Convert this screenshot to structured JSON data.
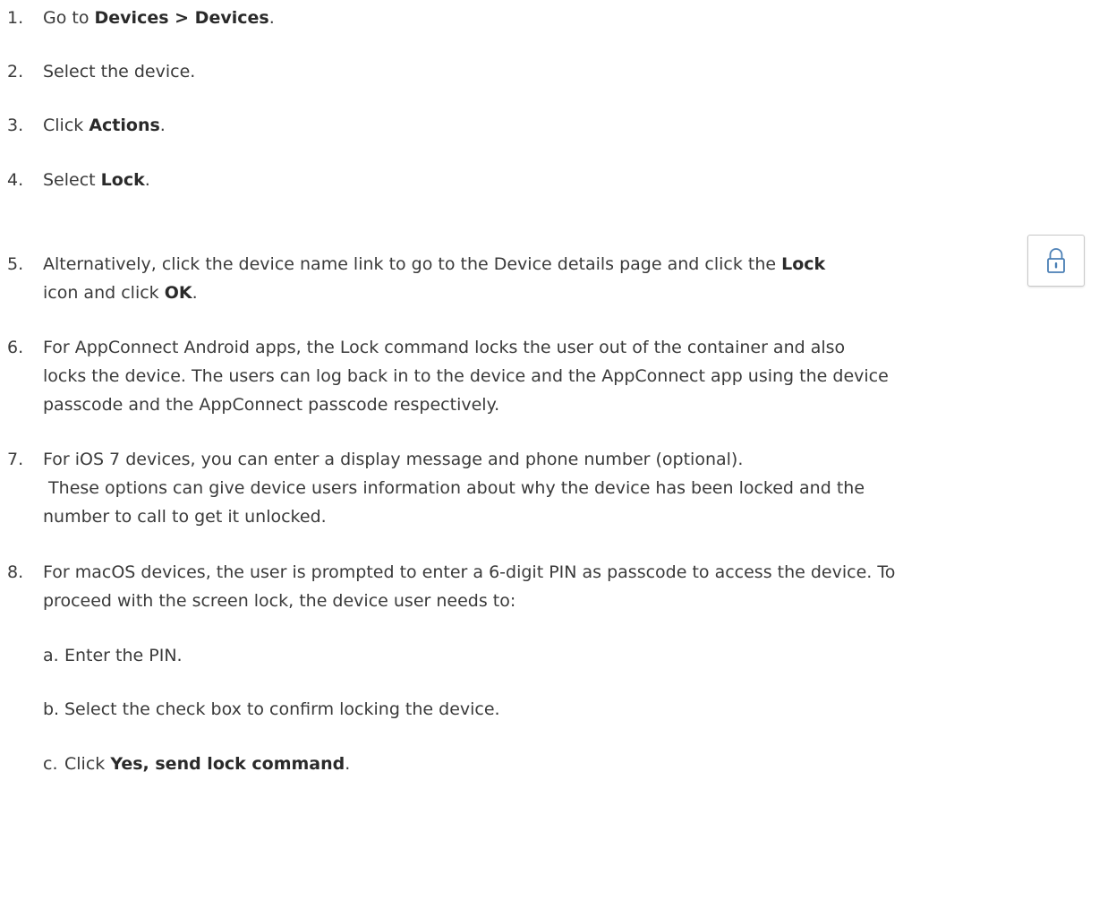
{
  "steps": [
    {
      "num": "1.",
      "a": "Go to ",
      "b1": "Devices > Devices",
      "c": "."
    },
    {
      "num": "2.",
      "a": "Select the device."
    },
    {
      "num": "3.",
      "a": "Click ",
      "b1": "Actions",
      "c": "."
    },
    {
      "num": "4.",
      "a": "Select ",
      "b1": "Lock",
      "c": "."
    },
    {
      "num": "5.",
      "line1": "Alternatively, click the device name link to go to the Device details page and click the ",
      "b1": "Lock",
      "line2a": "icon and click ",
      "b2": "OK",
      "line2b": "."
    },
    {
      "num": "6.",
      "lines": [
        "For AppConnect Android apps, the Lock command locks the user out of the container and also",
        "locks the device. The users can log back in to the device and the AppConnect app using the device",
        "passcode and the AppConnect passcode respectively."
      ]
    },
    {
      "num": "7.",
      "lines": [
        "For iOS 7 devices, you can enter a display message and phone number (optional).",
        " These options can give device users information about why the device has been locked and the",
        "number to call to get it unlocked."
      ]
    },
    {
      "num": "8.",
      "lines": [
        "For macOS devices, the user is prompted to enter a 6-digit PIN as passcode to access the device. To",
        "proceed with the screen lock, the device user needs to:"
      ]
    }
  ],
  "substeps": [
    {
      "num": "a.",
      "a": "Enter the PIN."
    },
    {
      "num": "b.",
      "a": "Select the check box to confirm locking the device."
    },
    {
      "num": "c.",
      "a": "Click ",
      "b1": "Yes, send lock command",
      "c": "."
    }
  ],
  "lock_icon": {
    "icon": "lock-icon",
    "color": "#4a7fb5"
  }
}
